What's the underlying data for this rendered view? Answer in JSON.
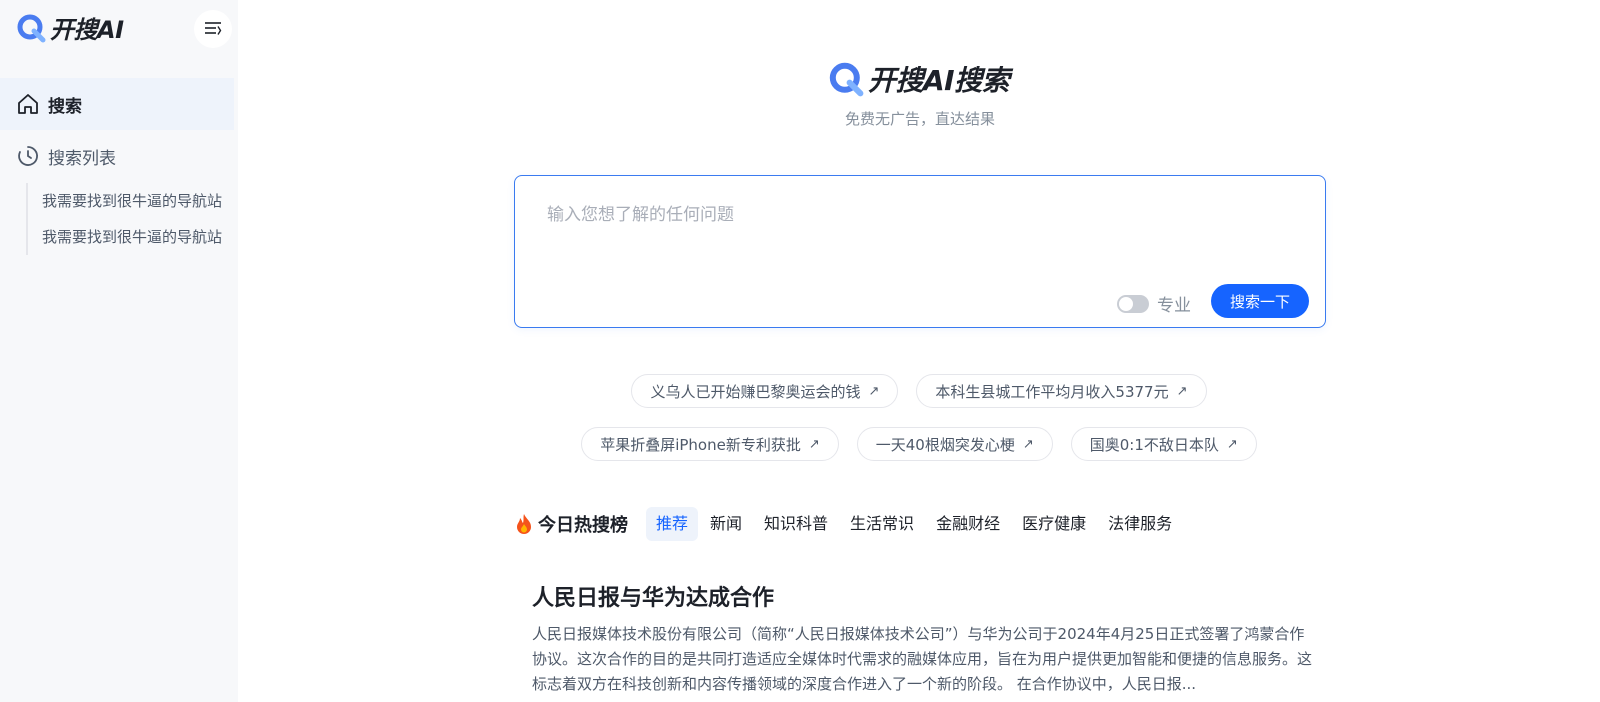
{
  "app": {
    "name": "开搜AI"
  },
  "sidebar": {
    "nav": [
      {
        "label": "搜索",
        "icon": "home-icon",
        "active": true
      },
      {
        "label": "搜索列表",
        "icon": "history-icon",
        "active": false
      }
    ],
    "history": [
      "我需要找到很牛逼的导航站",
      "我需要找到很牛逼的导航站"
    ]
  },
  "main": {
    "brand": "开搜AI搜索",
    "slogan": "免费无广告，直达结果",
    "search": {
      "placeholder": "输入您想了解的任何问题",
      "value": "",
      "pro_label": "专业",
      "pro_enabled": false,
      "button_label": "搜索一下"
    },
    "suggestions": [
      [
        "义乌人已开始赚巴黎奥运会的钱",
        "本科生县城工作平均月收入5377元"
      ],
      [
        "苹果折叠屏iPhone新专利获批",
        "一天40根烟突发心梗",
        "国奥0:1不敌日本队"
      ]
    ],
    "hot": {
      "title": "今日热搜榜",
      "tabs": [
        "推荐",
        "新闻",
        "知识科普",
        "生活常识",
        "金融财经",
        "医疗健康",
        "法律服务"
      ],
      "active_tab": 0,
      "article": {
        "title": "人民日报与华为达成合作",
        "body": "人民日报媒体技术股份有限公司（简称“人民日报媒体技术公司”）与华为公司于2024年4月25日正式签署了鸿蒙合作协议。这次合作的目的是共同打造适应全媒体时代需求的融媒体应用，旨在为用户提供更加智能和便捷的信息服务。这标志着双方在科技创新和内容传播领域的深度合作进入了一个新的阶段。 在合作协议中，人民日报..."
      }
    }
  },
  "colors": {
    "accent": "#1664ff",
    "border": "#3a7bf0",
    "sidebar_bg": "#f7f8fa"
  }
}
